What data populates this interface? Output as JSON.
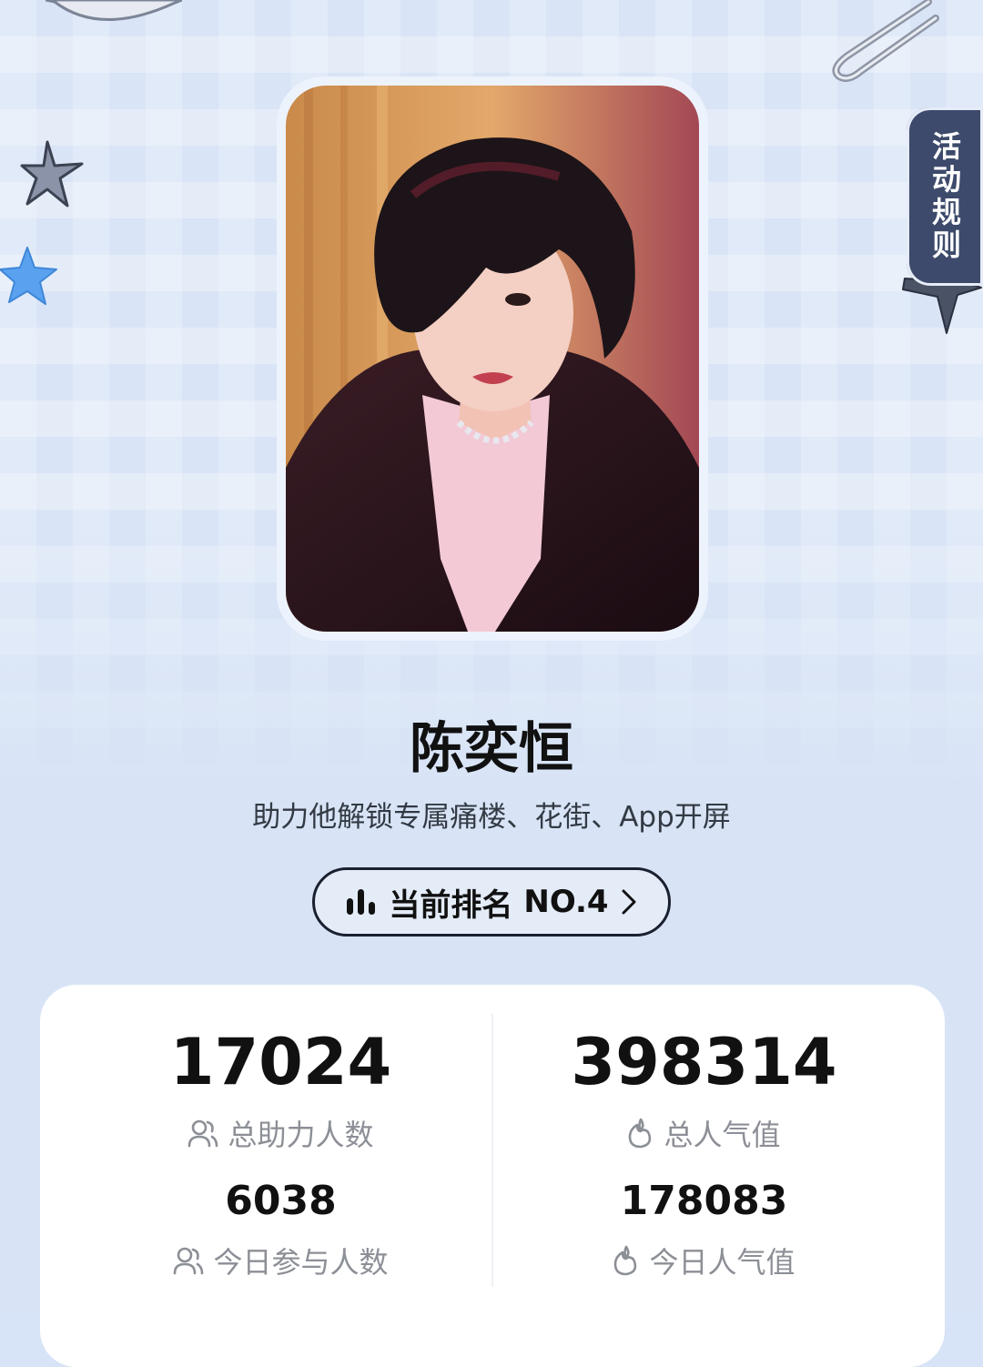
{
  "rules_tab": {
    "label": "活动规则"
  },
  "profile": {
    "name": "陈奕恒",
    "subtitle": "助力他解锁专属痛楼、花街、App开屏"
  },
  "rank": {
    "label": "当前排名",
    "value": "NO.4"
  },
  "stats": {
    "total_supporters": {
      "value": "17024",
      "label": "总助力人数",
      "icon": "users-icon"
    },
    "total_popularity": {
      "value": "398314",
      "label": "总人气值",
      "icon": "flame-icon"
    },
    "today_participants": {
      "value": "6038",
      "label": "今日参与人数",
      "icon": "users-icon"
    },
    "today_popularity": {
      "value": "178083",
      "label": "今日人气值",
      "icon": "flame-icon"
    }
  },
  "colors": {
    "background": "#d9e4f6",
    "tab": "#3d4a6b",
    "text": "#111111",
    "muted": "#8c8f96"
  }
}
